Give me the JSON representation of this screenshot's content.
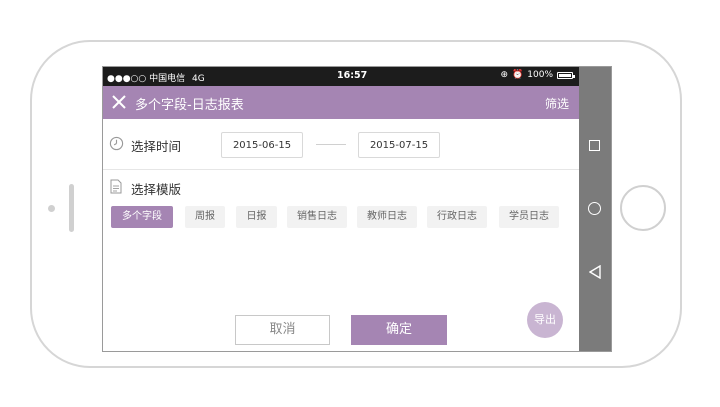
{
  "status_bar": {
    "carrier": "●●●○○ 中国电信",
    "network": "4G",
    "time": "16:57",
    "battery": "100%"
  },
  "app_bar": {
    "title": "多个字段-日志报表",
    "filter_label": "筛选"
  },
  "time_section": {
    "label": "选择时间",
    "start_date": "2015-06-15",
    "end_date": "2015-07-15"
  },
  "template_section": {
    "label": "选择模版",
    "chips": [
      {
        "label": "多个字段",
        "active": true
      },
      {
        "label": "周报",
        "active": false
      },
      {
        "label": "日报",
        "active": false
      },
      {
        "label": "销售日志",
        "active": false
      },
      {
        "label": "教师日志",
        "active": false
      },
      {
        "label": "行政日志",
        "active": false
      },
      {
        "label": "学员日志",
        "active": false
      }
    ]
  },
  "actions": {
    "cancel_label": "取消",
    "confirm_label": "确定",
    "export_label": "导出"
  },
  "colors": {
    "accent": "#a585b3",
    "status_bar_bg": "#1c1c1c",
    "nav_bar_bg": "#7b7b7b"
  }
}
